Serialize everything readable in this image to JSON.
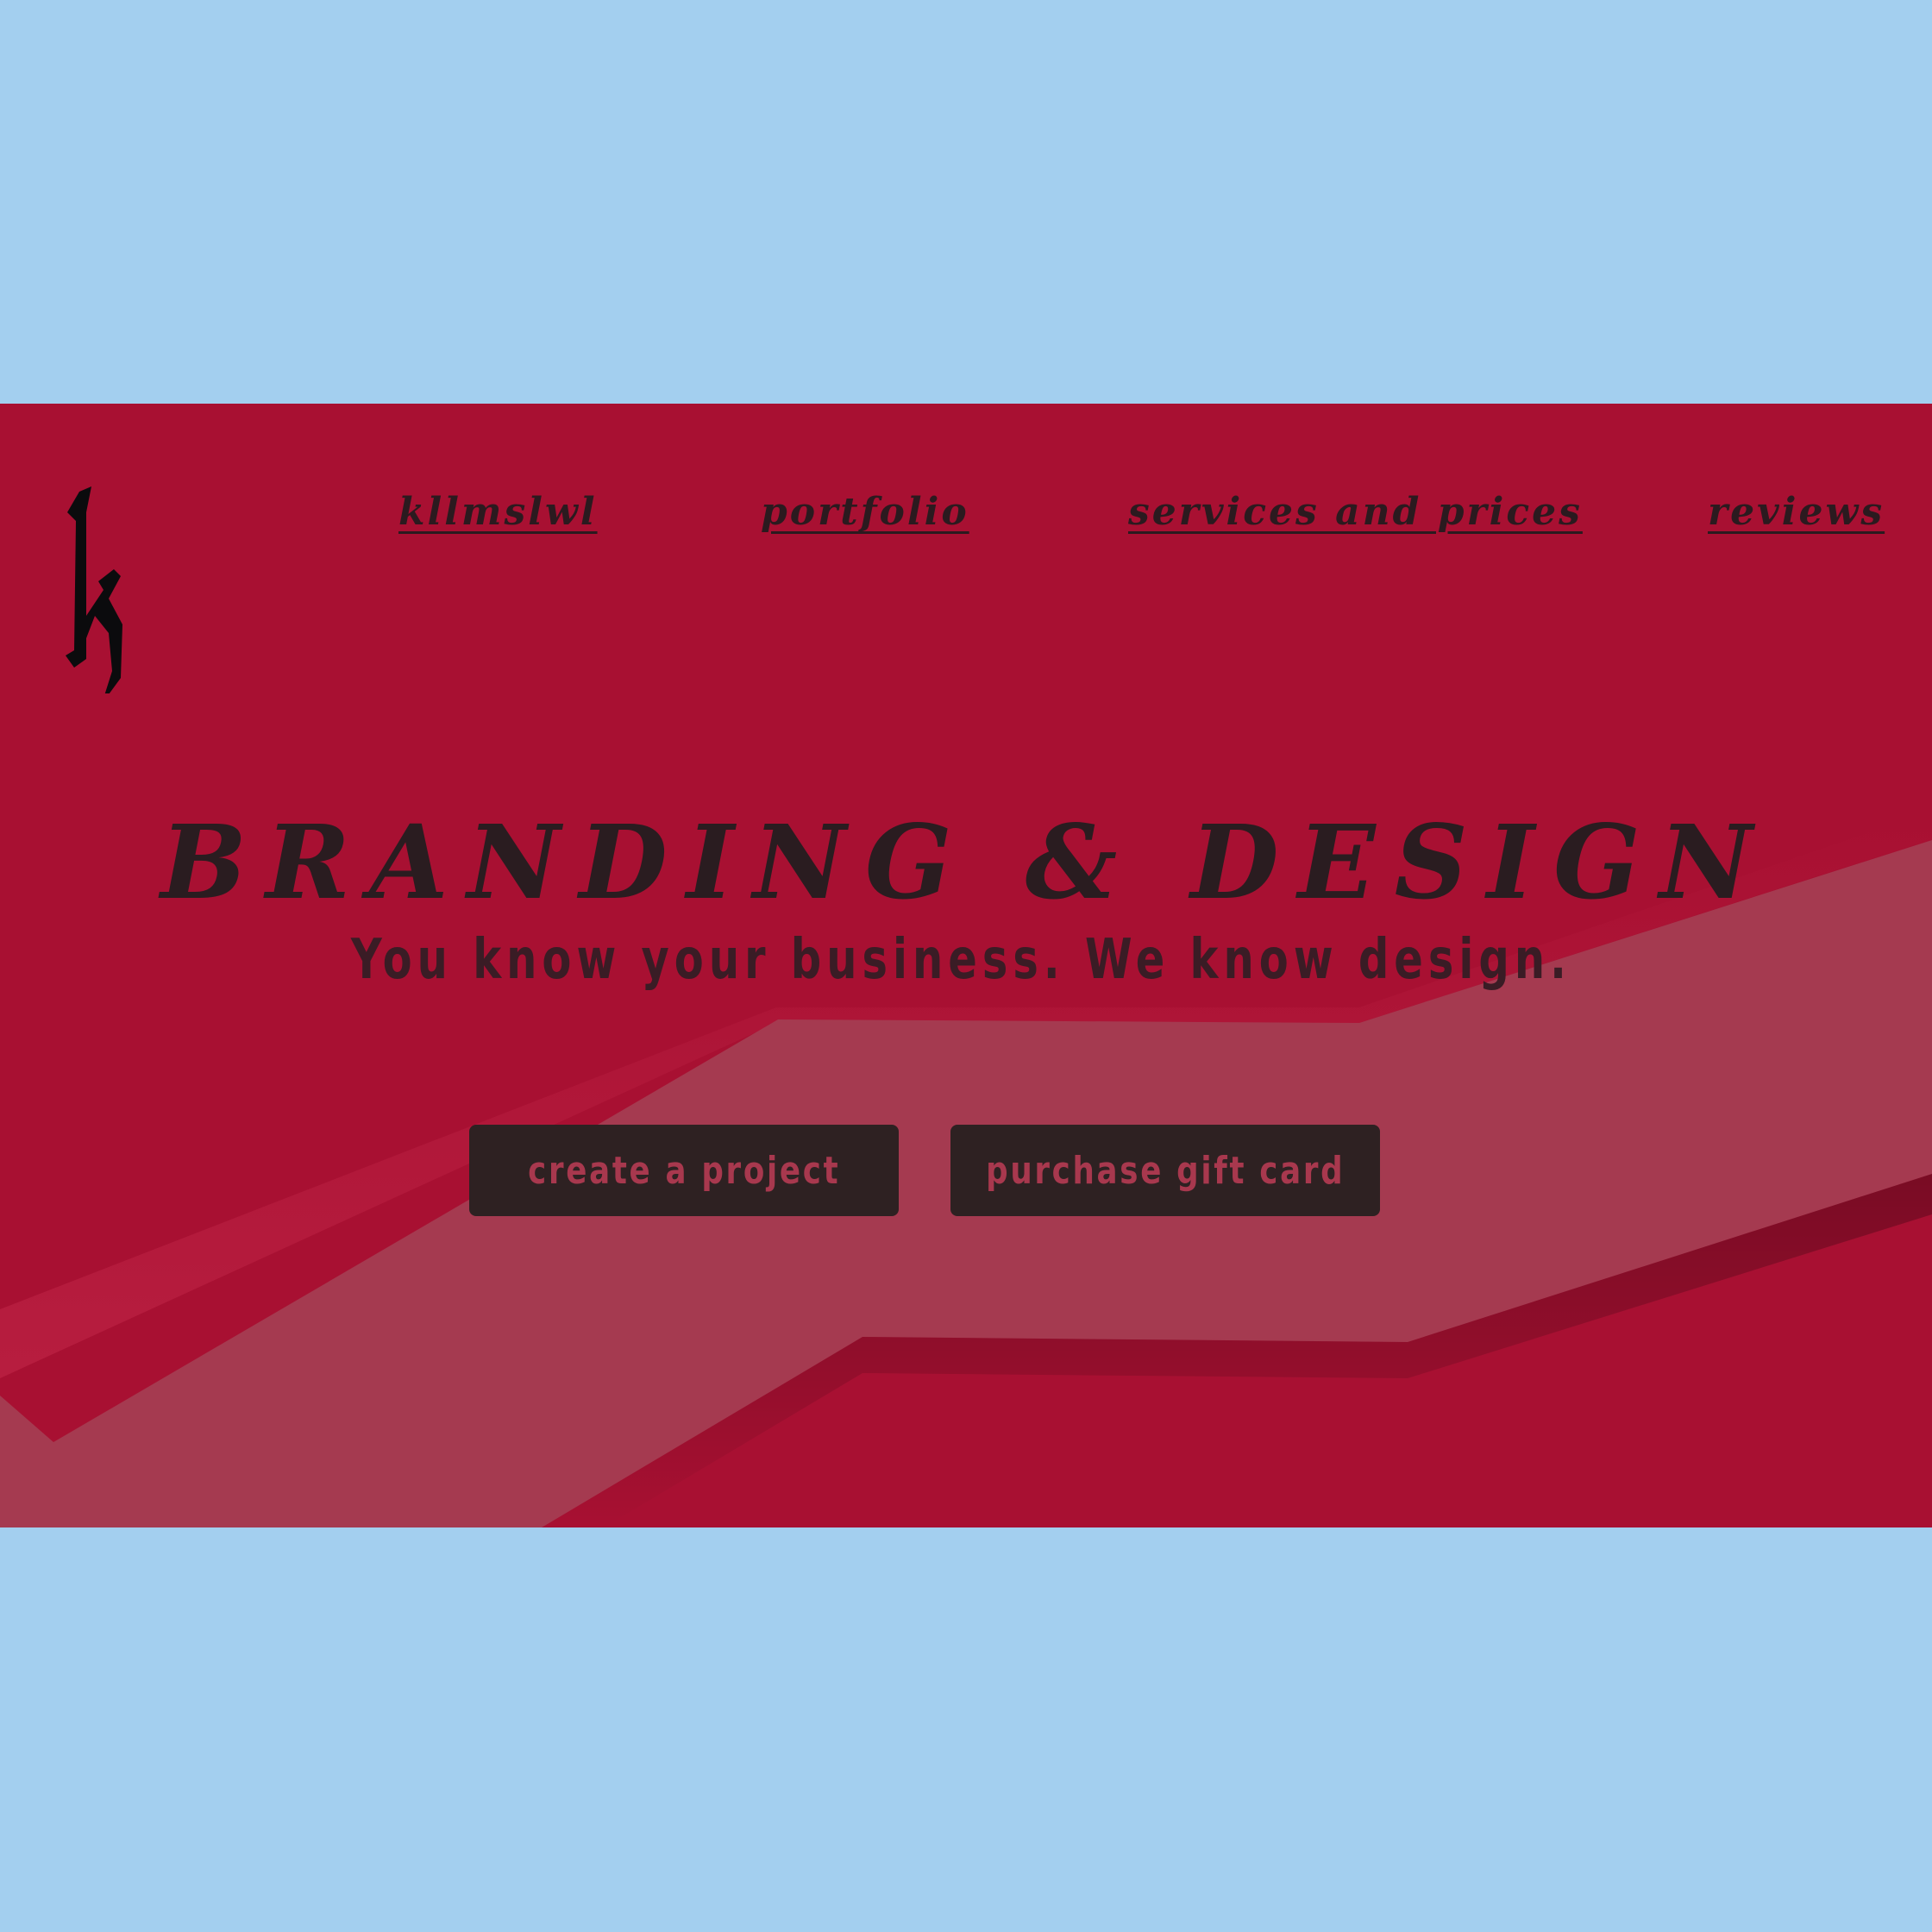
{
  "colors": {
    "page_background": "#a3cfef",
    "hero_background": "#a81032",
    "hero_band": "#a53a50",
    "text_dark": "#2b1a1f",
    "button_background": "#2e2122",
    "button_text": "#a8384e"
  },
  "logo": {
    "icon": "blackletter-k-logo",
    "letter": "k"
  },
  "nav": {
    "items": [
      {
        "label": "kllmslwl"
      },
      {
        "label": "portfolio"
      },
      {
        "label": "services and prices"
      },
      {
        "label": "reviews"
      }
    ]
  },
  "hero": {
    "title": "BRANDING & DESIGN",
    "subtitle": "You know your business. We know design."
  },
  "actions": {
    "primary_label": "create a project",
    "secondary_label": "purchase gift card"
  }
}
